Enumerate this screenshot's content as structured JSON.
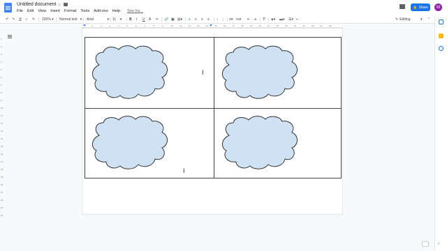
{
  "app": {
    "title": "Untitled document",
    "avatar_letter": "M",
    "share_label": "Share"
  },
  "menu": [
    "File",
    "Edit",
    "View",
    "Insert",
    "Format",
    "Tools",
    "Add-ons",
    "Help",
    "See his..."
  ],
  "toolbar": {
    "zoom": "100%",
    "style": "Normal text",
    "font": "Arial",
    "size": "11",
    "mode": "Editing"
  },
  "ruler": {
    "marks": [
      "1",
      "2",
      "3",
      "4",
      "5",
      "6",
      "7",
      "8",
      "9",
      "10",
      "11",
      "12",
      "13",
      "14",
      "15",
      "16",
      "17",
      "18",
      "19",
      "20",
      "21",
      "22",
      "23",
      "24",
      "25",
      "26",
      "27",
      "28"
    ]
  },
  "vruler": {
    "marks": [
      "1",
      "2",
      "3",
      "4",
      "5",
      "6",
      "7",
      "8",
      "9",
      "10",
      "11",
      "12",
      "13",
      "14",
      "15",
      "16",
      "17",
      "18",
      "19",
      "20",
      "21",
      "22",
      "23",
      "24"
    ]
  },
  "colors": {
    "cloud_fill": "#cfe2f3",
    "share_blue": "#1a73e8",
    "avatar": "#8e24aa"
  }
}
